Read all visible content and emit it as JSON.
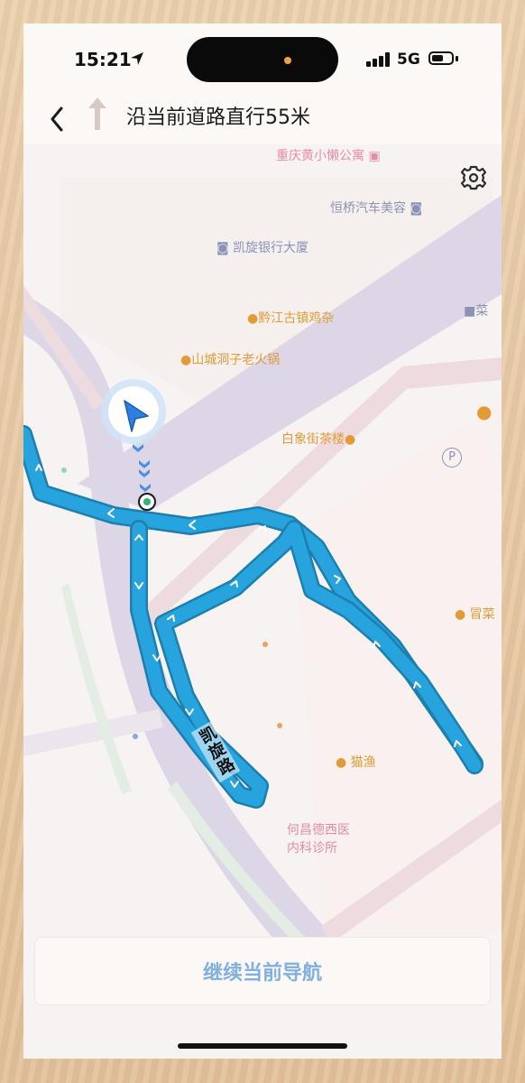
{
  "status_bar": {
    "time": "15:21",
    "network": "5G"
  },
  "navigation": {
    "instruction": "沿当前道路直行55米",
    "direction": "straight-up-arrow"
  },
  "map": {
    "road_label": "凯旋路",
    "pois": [
      {
        "name": "重庆黄小懒公寓",
        "icon": "building-icon"
      },
      {
        "name": "恒桥汽车美容",
        "icon": "car-icon"
      },
      {
        "name": "凯旋银行大厦",
        "icon": "building-icon"
      },
      {
        "name": "黔江古镇鸡杂",
        "icon": "food-icon"
      },
      {
        "name": "山城洞子老火锅",
        "icon": "food-icon"
      },
      {
        "name": "白象街茶楼",
        "icon": "food-icon"
      },
      {
        "name": "猫渔",
        "icon": "food-icon"
      },
      {
        "name": "何昌德西医\n内科诊所",
        "icon": "hospital-icon"
      },
      {
        "name": "菜",
        "icon": "truck-icon"
      },
      {
        "name": "冒菜",
        "icon": "food-icon"
      },
      {
        "name": "P",
        "icon": "parking-icon"
      }
    ]
  },
  "buttons": {
    "continue_navigation": "继续当前导航"
  },
  "colors": {
    "route": "#27a3de",
    "route_outline": "#1d7fae",
    "map_background": "#f7f3f2",
    "major_road": "#ddd6e6",
    "button_text": "#7fb0df",
    "poi_orange": "#e39b35"
  }
}
